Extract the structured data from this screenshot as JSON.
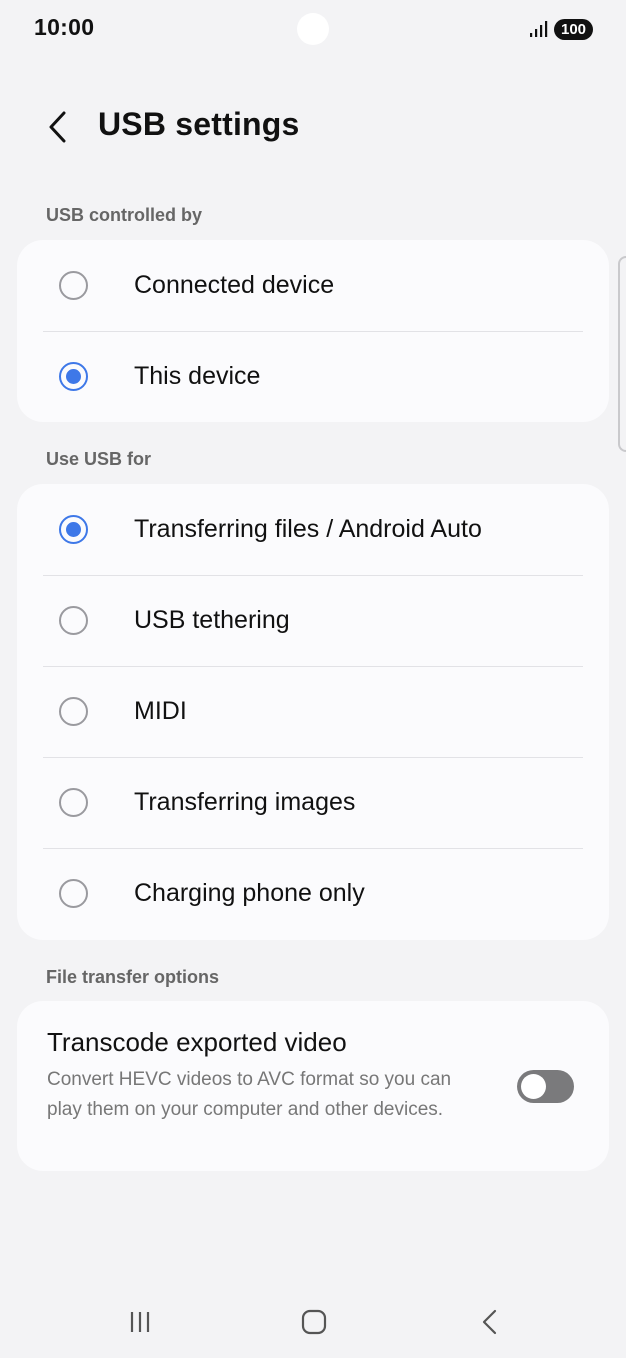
{
  "status_bar": {
    "time": "10:00",
    "battery": "100",
    "signal_icon": "signal-bars-icon"
  },
  "header": {
    "title": "USB settings",
    "back_icon": "chevron-left-icon"
  },
  "sections": {
    "controlled_by": {
      "label": "USB controlled by",
      "options": [
        {
          "label": "Connected device",
          "selected": false
        },
        {
          "label": "This device",
          "selected": true
        }
      ]
    },
    "use_usb_for": {
      "label": "Use USB for",
      "options": [
        {
          "label": "Transferring files / Android Auto",
          "selected": true
        },
        {
          "label": "USB tethering",
          "selected": false
        },
        {
          "label": "MIDI",
          "selected": false
        },
        {
          "label": "Transferring images",
          "selected": false
        },
        {
          "label": "Charging phone only",
          "selected": false
        }
      ]
    },
    "file_transfer": {
      "label": "File transfer options",
      "toggle": {
        "title": "Transcode exported video",
        "description": "Convert HEVC videos to AVC format so you can play them on your computer and other devices.",
        "enabled": false
      }
    }
  },
  "colors": {
    "accent": "#3e78e8",
    "background": "#f3f3f5",
    "card": "#fbfbfd",
    "toggle_off": "#7a7a7c"
  },
  "nav_bar": {
    "recents_icon": "recents-icon",
    "home_icon": "home-icon",
    "back_icon": "back-icon"
  }
}
